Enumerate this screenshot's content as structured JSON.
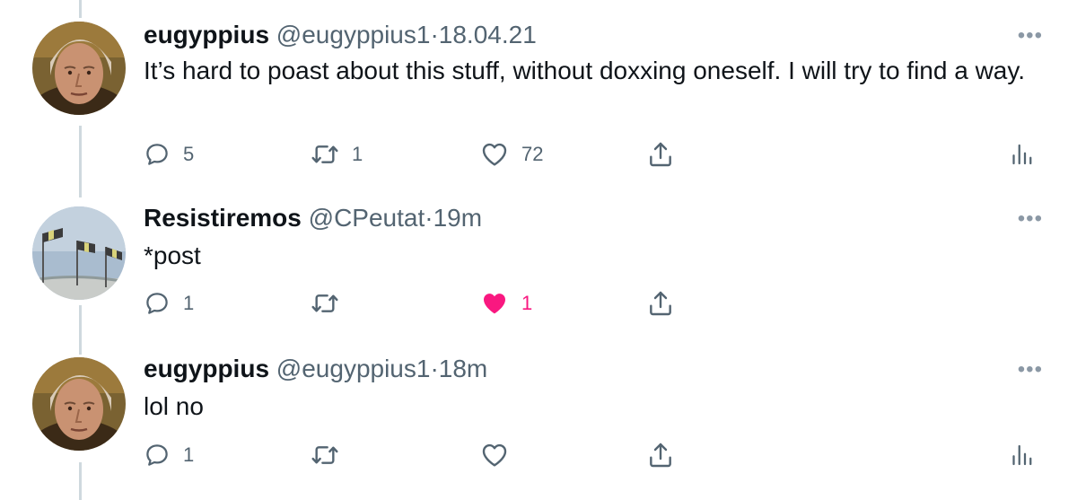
{
  "colors": {
    "text": "#0f1419",
    "secondary": "#536471",
    "thread_line": "#cfd9de",
    "like_active": "#f91880"
  },
  "tweets": [
    {
      "name": "eugyppius",
      "handle": "@eugyppius1",
      "separator": "·",
      "time": "18.04.21",
      "text": "It’s hard to poast about this stuff, without doxxing oneself. I will try to find a way.",
      "more": "•••",
      "avatar": "portrait-avatar",
      "replies": "5",
      "retweets": "1",
      "likes": "72",
      "liked": false,
      "analytics": true
    },
    {
      "name": "Resistiremos",
      "handle": "@CPeutat",
      "separator": "·",
      "time": "19m",
      "text": "*post",
      "more": "•••",
      "avatar": "flags-sky-avatar",
      "replies": "1",
      "retweets": "",
      "likes": "1",
      "liked": true,
      "analytics": false
    },
    {
      "name": "eugyppius",
      "handle": "@eugyppius1",
      "separator": "·",
      "time": "18m",
      "text": "lol no",
      "more": "•••",
      "avatar": "portrait-avatar",
      "replies": "1",
      "retweets": "",
      "likes": "",
      "liked": false,
      "analytics": true
    }
  ]
}
